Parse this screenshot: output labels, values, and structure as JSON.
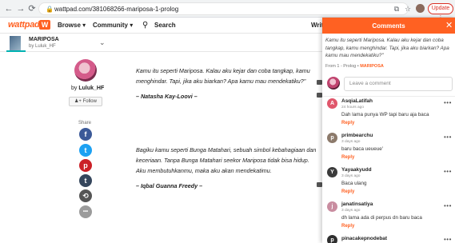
{
  "browser": {
    "back_icon": "←",
    "forward_icon": "→",
    "reload_icon": "⟳",
    "lock_icon": "🔒",
    "url": "wattpad.com/381068266-mariposa-1-prolog",
    "translate_icon": "⧉",
    "star_icon": "☆",
    "update_label": "Update ⋮"
  },
  "header": {
    "logo_text": "wattpad",
    "logo_mark": "W",
    "browse_label": "Browse ▾",
    "community_label": "Community ▾",
    "search_icon": "⚲",
    "search_label": "Search",
    "write_label": "Writ"
  },
  "story": {
    "title": "MARIPOSA",
    "author": "by Luluk_HF",
    "chevron": "⌄"
  },
  "author_card": {
    "by": "by",
    "name": "Luluk_HF",
    "follow_label": "♟+ Follow"
  },
  "share": {
    "label": "Share",
    "facebook": "f",
    "twitter": "t",
    "pinterest": "p",
    "tumblr": "t",
    "link": "⟲",
    "more": "•••"
  },
  "content": {
    "para1": "Kamu itu seperti Mariposa. Kalau aku kejar dan coba tangkap, kamu menghindar. Tapi, jika aku biarkan? Apa kamu mau mendekatiku?\"",
    "sig1": "– Natasha Kay-Loovi –",
    "para2": "Bagiku kamu seperti Bunga Matahari, sebuah simbol kebahagiaan dan keceriaan. Tanpa Bunga Matahari seekor Mariposa tidak bisa hidup. Aku membutuhkanmu, maka aku akan mendekatimu.",
    "sig2": "– Iqbal Guanna Freedy –"
  },
  "comments_panel": {
    "title": "Comments",
    "close_icon": "✕",
    "quote": "Kamu itu seperti Mariposa. Kalau aku kejar dan coba tangkap, kamu menghindar. Tapi, jika aku biarkan? Apa kamu mau mendekatiku?\"",
    "source_prefix": "From 1 - Prolog  •",
    "source_tag": "MARIPOSA",
    "composer_placeholder": "Leave a comment",
    "reply_label": "Reply",
    "more_icon": "•••",
    "comments": [
      {
        "initial": "A",
        "name": "AsqiaLatifah",
        "time": "24 hours ago",
        "body": "Dah lama punya WP tapi baru aja baca",
        "color": "#e0566b"
      },
      {
        "initial": "p",
        "name": "primbearchu",
        "time": "3 days ago",
        "body": "baru baca ueueue'",
        "color": "#8c7a6b"
      },
      {
        "initial": "Y",
        "name": "Yayaakyudd",
        "time": "3 days ago",
        "body": "Baca ulang",
        "color": "#3b3b3b"
      },
      {
        "initial": "j",
        "name": "janatinsatiya",
        "time": "3 days ago",
        "body": "dh lama ada di perpus dn baru baca",
        "color": "#c98da0"
      },
      {
        "initial": "p",
        "name": "pinacakepnodebat",
        "time": "",
        "body": "",
        "color": "#2f2f2f"
      }
    ]
  },
  "colors": {
    "brand": "#ff6122",
    "facebook": "#3b5998",
    "twitter": "#1da1f2",
    "pinterest": "#cb2027",
    "tumblr": "#35465c",
    "link": "#555555",
    "more": "#9b9b9b"
  }
}
